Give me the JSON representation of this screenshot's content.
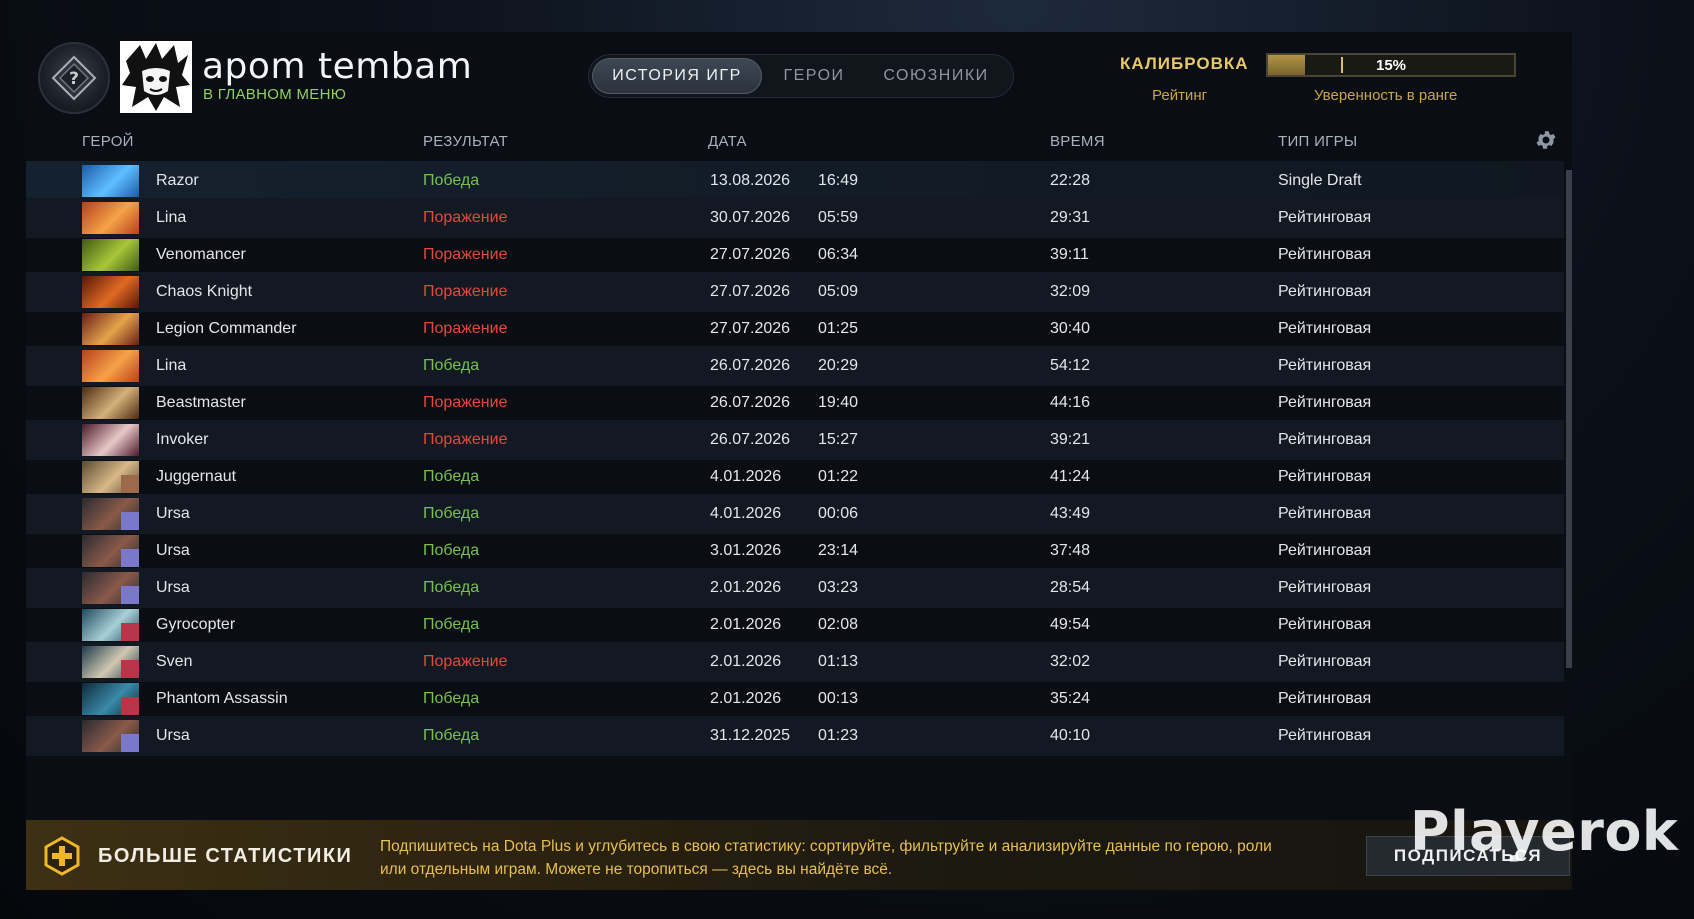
{
  "profile": {
    "name": "apom tembam",
    "status": "В ГЛАВНОМ МЕНЮ",
    "rank_icon": "calibration-rank-icon"
  },
  "tabs": [
    {
      "label": "ИСТОРИЯ ИГР",
      "active": true
    },
    {
      "label": "ГЕРОИ",
      "active": false
    },
    {
      "label": "СОЮЗНИКИ",
      "active": false
    }
  ],
  "calibration": {
    "title": "КАЛИБРОВКА",
    "rating_label": "Рейтинг",
    "confidence_label": "Уверенность в ранге",
    "confidence_text": "15%",
    "confidence_value": 15
  },
  "columns": {
    "hero": "ГЕРОЙ",
    "result": "РЕЗУЛЬТАТ",
    "date": "ДАТА",
    "duration": "ВРЕМЯ",
    "game_type": "ТИП ИГРЫ"
  },
  "matches": [
    {
      "hero": "Razor",
      "result": "Победа",
      "win": true,
      "date": "13.08.2026",
      "time": "16:49",
      "duration": "22:28",
      "type": "Single Draft",
      "portrait": [
        "#1d5aa8",
        "#5fc0ff"
      ],
      "badge": ""
    },
    {
      "hero": "Lina",
      "result": "Поражение",
      "win": false,
      "date": "30.07.2026",
      "time": "05:59",
      "duration": "29:31",
      "type": "Рейтинговая",
      "portrait": [
        "#b8401a",
        "#f5a24a"
      ],
      "badge": ""
    },
    {
      "hero": "Venomancer",
      "result": "Поражение",
      "win": false,
      "date": "27.07.2026",
      "time": "06:34",
      "duration": "39:11",
      "type": "Рейтинговая",
      "portrait": [
        "#3f5a12",
        "#a9c73a"
      ],
      "badge": ""
    },
    {
      "hero": "Chaos Knight",
      "result": "Поражение",
      "win": false,
      "date": "27.07.2026",
      "time": "05:09",
      "duration": "32:09",
      "type": "Рейтинговая",
      "portrait": [
        "#5a1608",
        "#e06a22"
      ],
      "badge": ""
    },
    {
      "hero": "Legion Commander",
      "result": "Поражение",
      "win": false,
      "date": "27.07.2026",
      "time": "01:25",
      "duration": "30:40",
      "type": "Рейтинговая",
      "portrait": [
        "#6a1c16",
        "#e3a44a"
      ],
      "badge": ""
    },
    {
      "hero": "Lina",
      "result": "Победа",
      "win": true,
      "date": "26.07.2026",
      "time": "20:29",
      "duration": "54:12",
      "type": "Рейтинговая",
      "portrait": [
        "#b8401a",
        "#f5a24a"
      ],
      "badge": ""
    },
    {
      "hero": "Beastmaster",
      "result": "Поражение",
      "win": false,
      "date": "26.07.2026",
      "time": "19:40",
      "duration": "44:16",
      "type": "Рейтинговая",
      "portrait": [
        "#4a2a14",
        "#d4b07a"
      ],
      "badge": ""
    },
    {
      "hero": "Invoker",
      "result": "Поражение",
      "win": false,
      "date": "26.07.2026",
      "time": "15:27",
      "duration": "39:21",
      "type": "Рейтинговая",
      "portrait": [
        "#4a1a2a",
        "#e8c8c8"
      ],
      "badge": ""
    },
    {
      "hero": "Juggernaut",
      "result": "Победа",
      "win": true,
      "date": "4.01.2026",
      "time": "01:22",
      "duration": "41:24",
      "type": "Рейтинговая",
      "portrait": [
        "#5a4a30",
        "#d8b888"
      ],
      "badge": "#9a6a4a"
    },
    {
      "hero": "Ursa",
      "result": "Победа",
      "win": true,
      "date": "4.01.2026",
      "time": "00:06",
      "duration": "43:49",
      "type": "Рейтинговая",
      "portrait": [
        "#2a2a30",
        "#8a5a4a"
      ],
      "badge": "#7a78c8"
    },
    {
      "hero": "Ursa",
      "result": "Победа",
      "win": true,
      "date": "3.01.2026",
      "time": "23:14",
      "duration": "37:48",
      "type": "Рейтинговая",
      "portrait": [
        "#2a2a30",
        "#8a5a4a"
      ],
      "badge": "#7a78c8"
    },
    {
      "hero": "Ursa",
      "result": "Победа",
      "win": true,
      "date": "2.01.2026",
      "time": "03:23",
      "duration": "28:54",
      "type": "Рейтинговая",
      "portrait": [
        "#2a2a30",
        "#8a5a4a"
      ],
      "badge": "#7a78c8"
    },
    {
      "hero": "Gyrocopter",
      "result": "Победа",
      "win": true,
      "date": "2.01.2026",
      "time": "02:08",
      "duration": "49:54",
      "type": "Рейтинговая",
      "portrait": [
        "#1e4a5a",
        "#a8d0d8"
      ],
      "badge": "#b8354a"
    },
    {
      "hero": "Sven",
      "result": "Поражение",
      "win": false,
      "date": "2.01.2026",
      "time": "01:13",
      "duration": "32:02",
      "type": "Рейтинговая",
      "portrait": [
        "#1e3a4a",
        "#d0c8b0"
      ],
      "badge": "#b8354a"
    },
    {
      "hero": "Phantom Assassin",
      "result": "Победа",
      "win": true,
      "date": "2.01.2026",
      "time": "00:13",
      "duration": "35:24",
      "type": "Рейтинговая",
      "portrait": [
        "#0e2a3a",
        "#3a8aa8"
      ],
      "badge": "#b8354a"
    },
    {
      "hero": "Ursa",
      "result": "Победа",
      "win": true,
      "date": "31.12.2025",
      "time": "01:23",
      "duration": "40:10",
      "type": "Рейтинговая",
      "portrait": [
        "#2a2a30",
        "#8a5a4a"
      ],
      "badge": "#7a78c8"
    }
  ],
  "colors": {
    "win": "#78c14f",
    "loss": "#e14a3c",
    "gold": "#e8c767",
    "status_green": "#8fd163"
  },
  "promo": {
    "title": "БОЛЬШЕ СТАТИСТИКИ",
    "text": "Подпишитесь на Dota Plus и углубитесь в свою статистику: сортируйте, фильтруйте и анализируйте данные по герою, роли или отдельным играм. Можете не торопиться — здесь вы найдёте всё.",
    "button": "ПОДПИСАТЬСЯ",
    "icon": "dota-plus-icon"
  },
  "watermark": "Playerok"
}
